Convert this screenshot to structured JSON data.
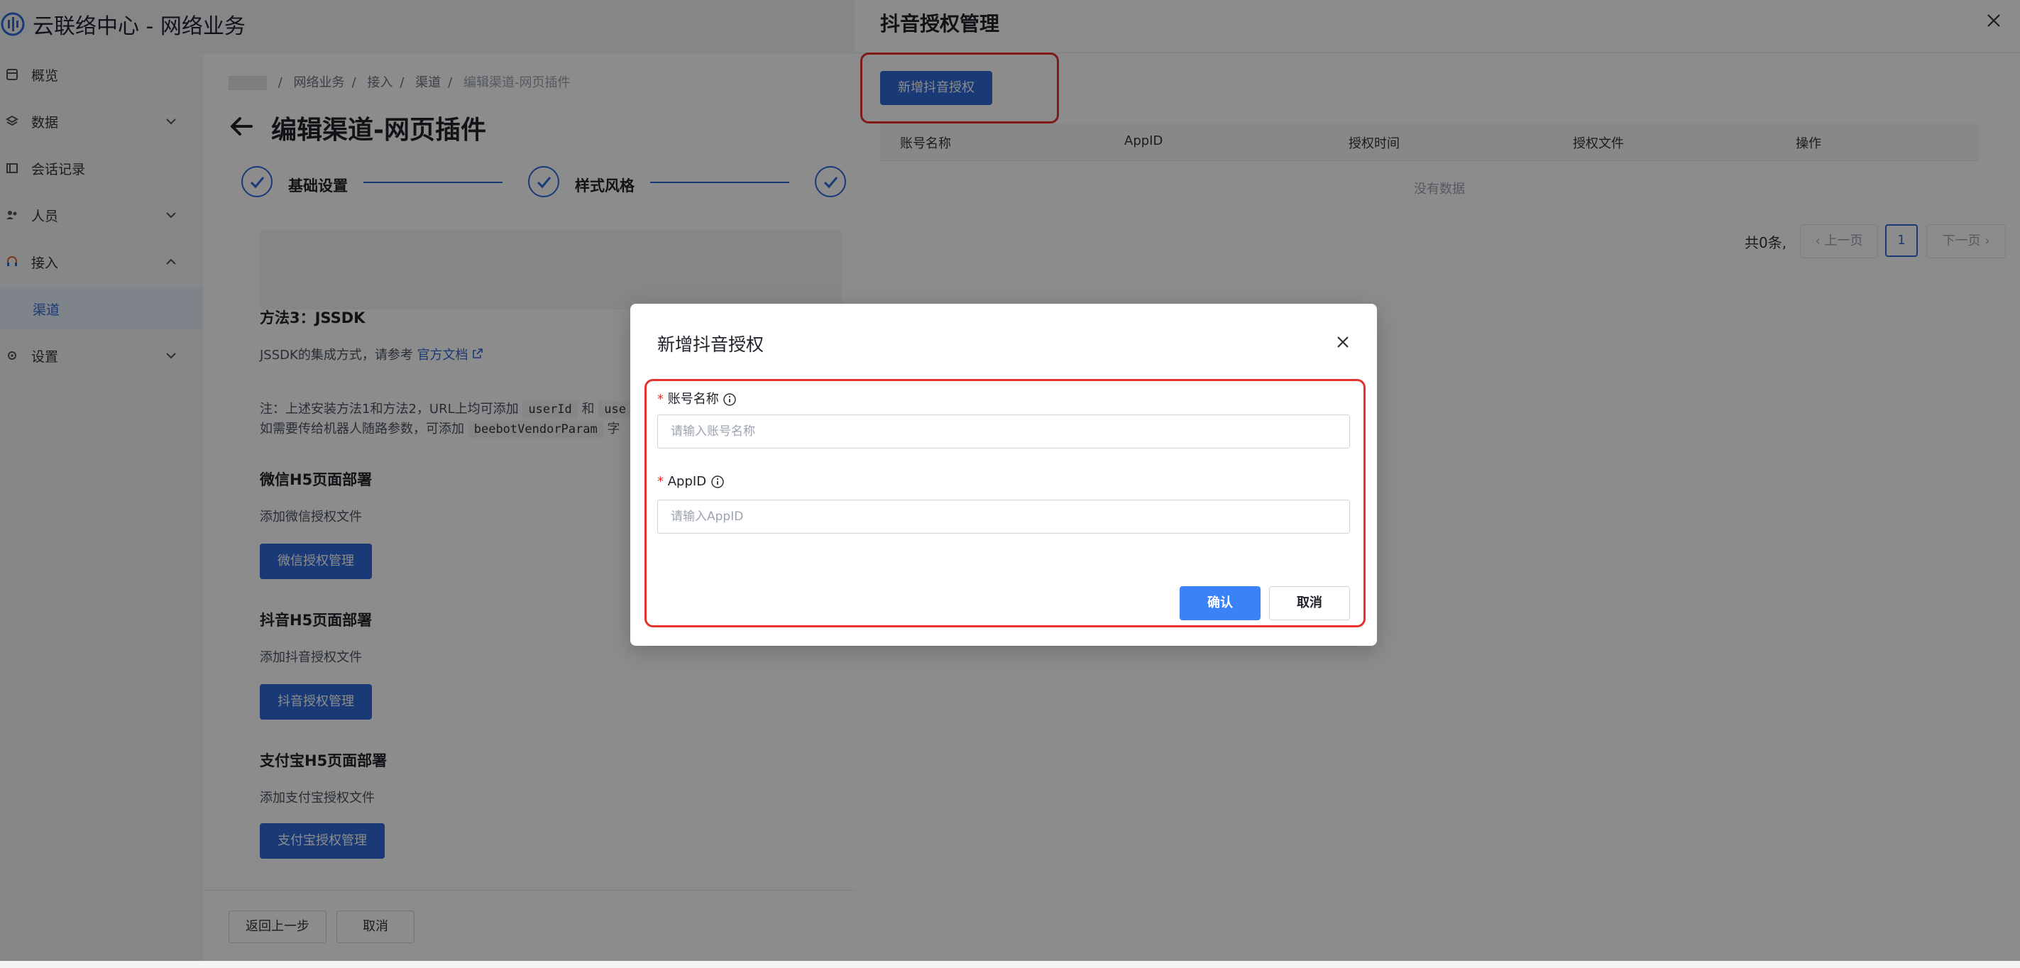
{
  "header": {
    "app_title": "云联络中心 - 网络业务"
  },
  "sidebar": {
    "items": [
      {
        "label": "概览",
        "icon": "overview-icon",
        "has_chevron": false
      },
      {
        "label": "数据",
        "icon": "data-icon",
        "has_chevron": true
      },
      {
        "label": "会话记录",
        "icon": "chat-record-icon",
        "has_chevron": false
      },
      {
        "label": "人员",
        "icon": "people-icon",
        "has_chevron": true
      },
      {
        "label": "接入",
        "icon": "headset-icon",
        "has_chevron": true,
        "expanded": true
      },
      {
        "label": "渠道",
        "icon": "",
        "has_chevron": false,
        "active": true
      },
      {
        "label": "设置",
        "icon": "gear-icon",
        "has_chevron": true
      }
    ]
  },
  "main": {
    "breadcrumbs": [
      "网络业务",
      "接入",
      "渠道",
      "编辑渠道-网页插件"
    ],
    "title": "编辑渠道-网页插件",
    "steps": [
      "基础设置",
      "样式风格"
    ],
    "method3_title": "方法3：JSSDK",
    "method3_text": "JSSDK的集成方式，请参考",
    "method3_link": "官方文档",
    "note_line1_prefix": "注：上述安装方法1和方法2，URL上均可添加",
    "note_code1": "userId",
    "note_and": "和",
    "note_code2": "use",
    "note_line2_prefix": "如需要传给机器人随路参数，可添加",
    "note_code3": "beebotVendorParam",
    "note_line2_suffix": "字",
    "wechat_title": "微信H5页面部署",
    "wechat_text": "添加微信授权文件",
    "wechat_button": "微信授权管理",
    "douyin_title": "抖音H5页面部署",
    "douyin_text": "添加抖音授权文件",
    "douyin_button": "抖音授权管理",
    "alipay_title": "支付宝H5页面部署",
    "alipay_text": "添加支付宝授权文件",
    "alipay_button": "支付宝授权管理",
    "footer_back": "返回上一步",
    "footer_cancel": "取消"
  },
  "drawer": {
    "title": "抖音授权管理",
    "add_button": "新增抖音授权",
    "columns": [
      "账号名称",
      "AppID",
      "授权时间",
      "授权文件",
      "操作"
    ],
    "empty_text": "没有数据",
    "total": "共0条,",
    "prev": "上一页",
    "page": "1",
    "next": "下一页"
  },
  "modal": {
    "title": "新增抖音授权",
    "fields": [
      {
        "label": "账号名称",
        "placeholder": "请输入账号名称",
        "required": true
      },
      {
        "label": "AppID",
        "placeholder": "请输入AppID",
        "required": true
      }
    ],
    "confirm": "确认",
    "cancel": "取消"
  },
  "colors": {
    "primary": "#2f6bd8",
    "highlight": "#e5322d",
    "confirm": "#3b82f6"
  }
}
